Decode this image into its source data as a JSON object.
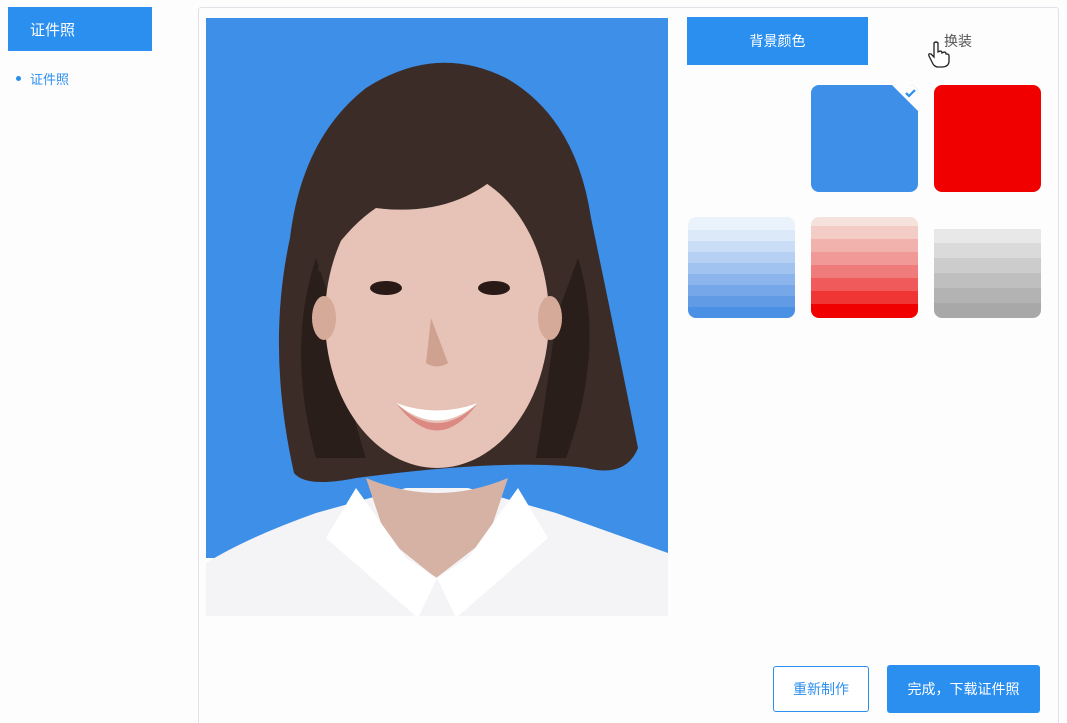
{
  "sidebar": {
    "header": "证件照",
    "items": [
      {
        "label": "证件照"
      }
    ]
  },
  "tabs": {
    "background_color": "背景颜色",
    "change_outfit": "换装"
  },
  "swatches": [
    {
      "name": "blue",
      "color": "#3d8fe8",
      "selected": true
    },
    {
      "name": "red",
      "color": "#f10000",
      "selected": false
    },
    {
      "name": "blue-gradient",
      "colors": [
        "#e8f1fb",
        "#4a92e4"
      ],
      "selected": false
    },
    {
      "name": "red-gradient",
      "colors": [
        "#f3ddd6",
        "#f10000"
      ],
      "selected": false
    },
    {
      "name": "gray-gradient",
      "colors": [
        "#ebebeb",
        "#a8a8a8"
      ],
      "selected": false
    }
  ],
  "buttons": {
    "remake": "重新制作",
    "finish_download": "完成，下载证件照"
  },
  "colors": {
    "accent": "#2b8ff0",
    "photo_background": "#3d8fe8"
  }
}
